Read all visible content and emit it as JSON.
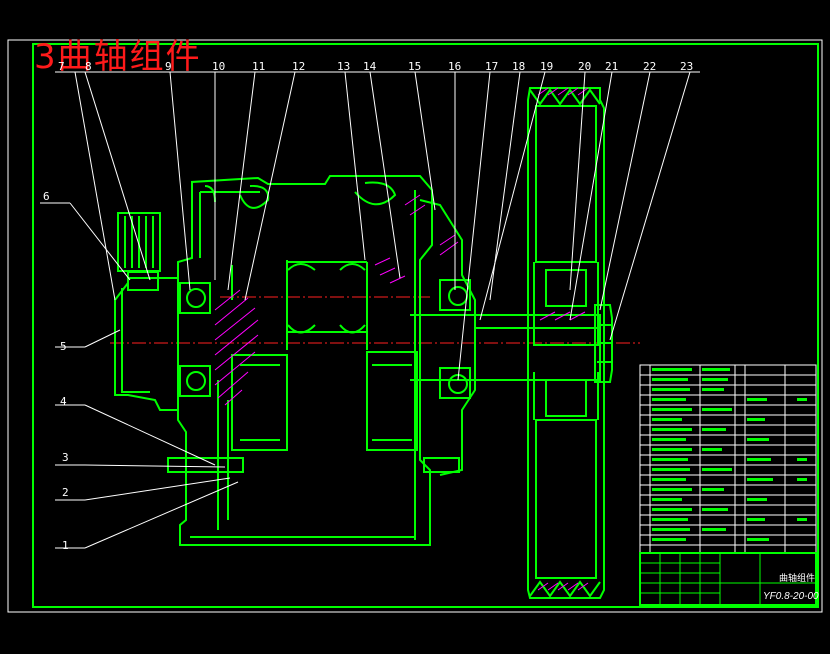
{
  "title": "3曲轴组件",
  "balloons": {
    "top": [
      "7",
      "8",
      "9",
      "10",
      "11",
      "12",
      "13",
      "14",
      "15",
      "16",
      "17",
      "18",
      "19",
      "20",
      "21",
      "22",
      "23"
    ],
    "left": [
      "6",
      "5",
      "4",
      "3",
      "2",
      "1"
    ]
  },
  "title_block": {
    "name": "曲轴组件",
    "code": "YF0.8-20-00"
  },
  "colors": {
    "background": "#000000",
    "drawing": "#00ff00",
    "leader": "#ffffff",
    "centerline": "#ff2020",
    "hatch": "#ff00ff",
    "title": "#ff1a1a"
  }
}
